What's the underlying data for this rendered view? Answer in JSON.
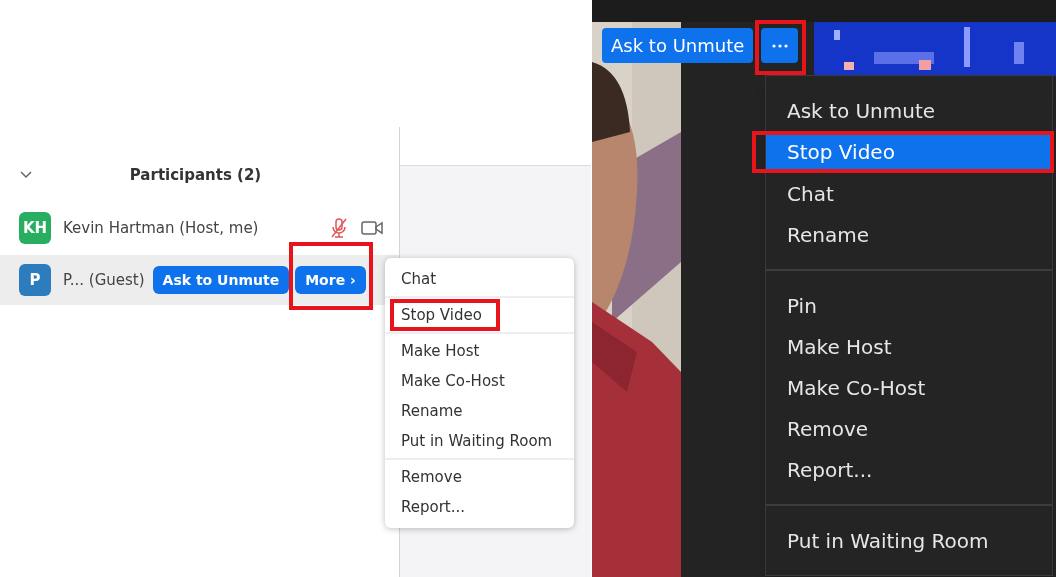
{
  "light_view": {
    "participants_panel": {
      "title": "Participants (2)",
      "expanded": true,
      "participants": [
        {
          "initials": "KH",
          "color": "#27ae60",
          "name": "Kevin Hartman (Host, me)",
          "hovered": false,
          "kind": "status",
          "muted": true,
          "video_on": true
        },
        {
          "initials": "P",
          "color": "#2d7dbe",
          "name": "P... (Guest)",
          "hovered": true,
          "kind": "actions",
          "actions": [
            {
              "label": "Ask to Unmute",
              "annotated": false
            },
            {
              "label": "More ›",
              "annotated": true
            }
          ]
        }
      ]
    },
    "menu": {
      "sections": [
        [
          {
            "label": "Chat",
            "annotated": false
          }
        ],
        [
          {
            "label": "Stop Video",
            "annotated": true
          }
        ],
        [
          {
            "label": "Make Host",
            "annotated": false
          },
          {
            "label": "Make Co-Host",
            "annotated": false
          },
          {
            "label": "Rename",
            "annotated": false
          },
          {
            "label": "Put in Waiting Room",
            "annotated": false
          }
        ],
        [
          {
            "label": "Remove",
            "annotated": false
          },
          {
            "label": "Report...",
            "annotated": false
          }
        ]
      ]
    }
  },
  "dark_view": {
    "overlay_buttons": [
      {
        "kind": "text",
        "label": "Ask to Unmute",
        "annotated": false
      },
      {
        "kind": "more",
        "annotated": true
      }
    ],
    "menu": {
      "sections": [
        [
          {
            "label": "Ask to Unmute",
            "selected": false,
            "annotated": false
          },
          {
            "label": "Stop Video",
            "selected": true,
            "annotated": true
          },
          {
            "label": "Chat",
            "selected": false,
            "annotated": false
          },
          {
            "label": "Rename",
            "selected": false,
            "annotated": false
          }
        ],
        [
          {
            "label": "Pin",
            "selected": false,
            "annotated": false
          },
          {
            "label": "Make Host",
            "selected": false,
            "annotated": false
          },
          {
            "label": "Make Co-Host",
            "selected": false,
            "annotated": false
          },
          {
            "label": "Remove",
            "selected": false,
            "annotated": false
          },
          {
            "label": "Report...",
            "selected": false,
            "annotated": false
          }
        ],
        [
          {
            "label": "Put in Waiting Room",
            "selected": false,
            "annotated": false
          }
        ]
      ]
    }
  }
}
